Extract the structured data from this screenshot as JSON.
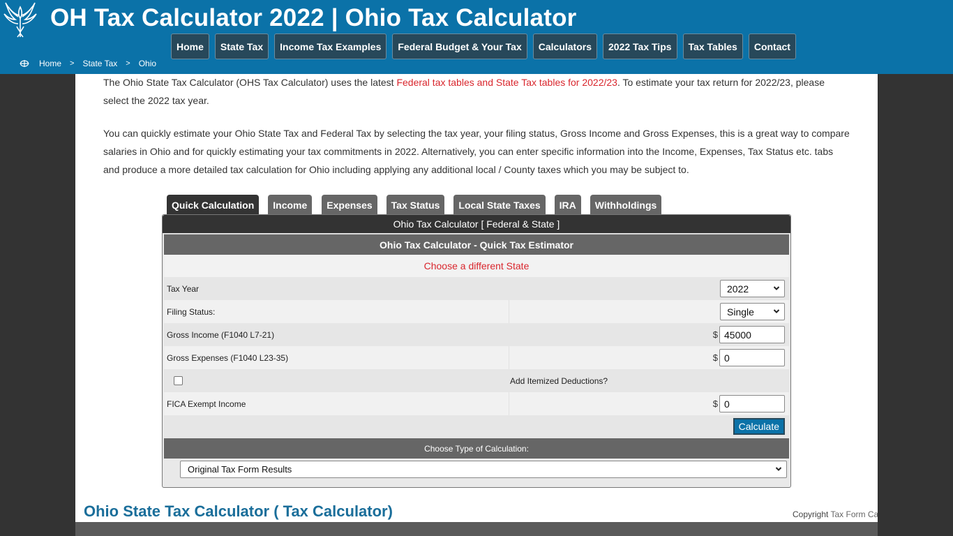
{
  "header": {
    "title": "OH Tax Calculator 2022 | Ohio Tax Calculator",
    "logo_icon": "phoenix-logo-icon",
    "nav": [
      {
        "label": "Home"
      },
      {
        "label": "State Tax"
      },
      {
        "label": "Income Tax Examples"
      },
      {
        "label": "Federal Budget & Your Tax"
      },
      {
        "label": "Calculators"
      },
      {
        "label": "2022 Tax Tips"
      },
      {
        "label": "Tax Tables"
      },
      {
        "label": "Contact"
      }
    ],
    "breadcrumb": {
      "icon": "globe-icon",
      "items": [
        "Home",
        "State Tax",
        "Ohio"
      ],
      "separator": ">"
    }
  },
  "intro": {
    "p1_before": "The Ohio State Tax Calculator (OHS Tax Calculator) uses the latest ",
    "p1_link": "Federal tax tables and State Tax tables for 2022/23",
    "p1_after": ". To estimate your tax return for 2022/23, please select the 2022 tax year.",
    "p2": "You can quickly estimate your Ohio State Tax and Federal Tax by selecting the tax year, your filing status, Gross Income and Gross Expenses, this is a great way to compare salaries in Ohio and for quickly estimating your tax commitments in 2022. Alternatively, you can enter specific information into the Income, Expenses, Tax Status etc. tabs and produce a more detailed tax calculation for Ohio including applying any additional local / County taxes which you may be subject to."
  },
  "tabs": [
    {
      "label": "Quick Calculation",
      "active": true
    },
    {
      "label": "Income",
      "active": false
    },
    {
      "label": "Expenses",
      "active": false
    },
    {
      "label": "Tax Status",
      "active": false
    },
    {
      "label": "Local State Taxes",
      "active": false
    },
    {
      "label": "IRA",
      "active": false
    },
    {
      "label": "Withholdings",
      "active": false
    }
  ],
  "calculator": {
    "top_title": "Ohio Tax Calculator [ Federal & State ]",
    "estimator_title": "Ohio Tax Calculator - Quick Tax Estimator",
    "change_state_link": "Choose a different State",
    "tax_year": {
      "label": "Tax Year",
      "value": "2022"
    },
    "filing_status": {
      "label": "Filing Status:",
      "value": "Single"
    },
    "gross_income": {
      "label": "Gross Income (F1040 L7-21)",
      "currency": "$",
      "value": "45000"
    },
    "gross_expenses": {
      "label": "Gross Expenses (F1040 L23-35)",
      "currency": "$",
      "value": "0"
    },
    "itemized": {
      "label": "Add Itemized Deductions?",
      "checked": false
    },
    "fica_exempt": {
      "label": "FICA Exempt Income",
      "currency": "$",
      "value": "0"
    },
    "calculate_button": "Calculate",
    "calc_type_label": "Choose Type of Calculation:",
    "calc_type_value": "Original Tax Form Results"
  },
  "footer": {
    "subtitle": "Ohio State Tax Calculator ( Tax Calculator)",
    "copyright_prefix": "Copyright ",
    "copyright_link": "Tax Form Cal"
  },
  "colors": {
    "header_bg": "#0b72a8",
    "nav_button_bg": "#27485a",
    "link_red": "#d9262d",
    "subtitle_blue": "#1a6e9a",
    "page_bg": "#333333"
  }
}
